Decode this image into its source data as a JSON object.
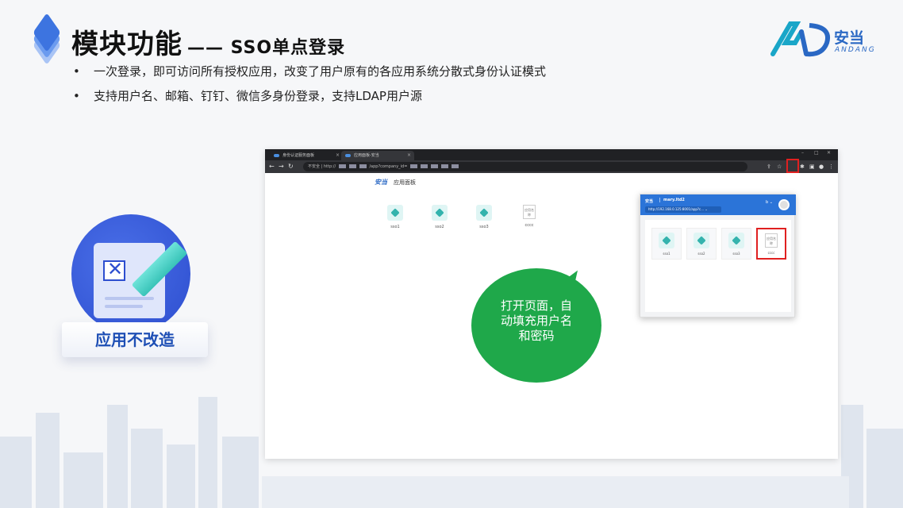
{
  "slide": {
    "title": "模块功能",
    "subtitle": "—— SSO单点登录",
    "bullets": [
      "一次登录，即可访问所有授权应用，改变了用户原有的各应用系统分散式身份认证模式",
      "支持用户名、邮箱、钉钉、微信多身份登录，支持LDAP用户源"
    ],
    "bullet_marker": "•"
  },
  "brand": {
    "name": "安当",
    "name_en": "ANDANG",
    "accent": "#2a68c4"
  },
  "illustration": {
    "plate_label": "应用不改造",
    "plate_color": "#1e4fb5"
  },
  "browser": {
    "tabs": [
      {
        "label": "身份认证服务面板"
      },
      {
        "label": "应用面板-安当"
      }
    ],
    "tab_close": "×",
    "address": "不安全 | http://",
    "address_tail": "/app?company_id=",
    "page_title": "应用面板",
    "apps": [
      {
        "name": "sso1",
        "icon": "cube-icon"
      },
      {
        "name": "sso2",
        "icon": "cube-icon"
      },
      {
        "name": "sso3",
        "icon": "cube-icon"
      },
      {
        "name": "cccc",
        "icon": "tile-icon",
        "tile_text": "应用名称"
      }
    ]
  },
  "popup": {
    "user": "mary.ltd2",
    "url": "http://192.168.0.125:8001/app?c...",
    "user_badge": "b",
    "apps": [
      {
        "name": "sso1"
      },
      {
        "name": "sso2"
      },
      {
        "name": "sso3"
      },
      {
        "name": "cccc",
        "selected": true
      }
    ]
  },
  "callout": {
    "lines": [
      "打开页面，自",
      "动填充用户名",
      "和密码"
    ],
    "color": "#1fa84a"
  },
  "colors": {
    "highlight": "#e02020",
    "browser_dark": "#202124"
  }
}
